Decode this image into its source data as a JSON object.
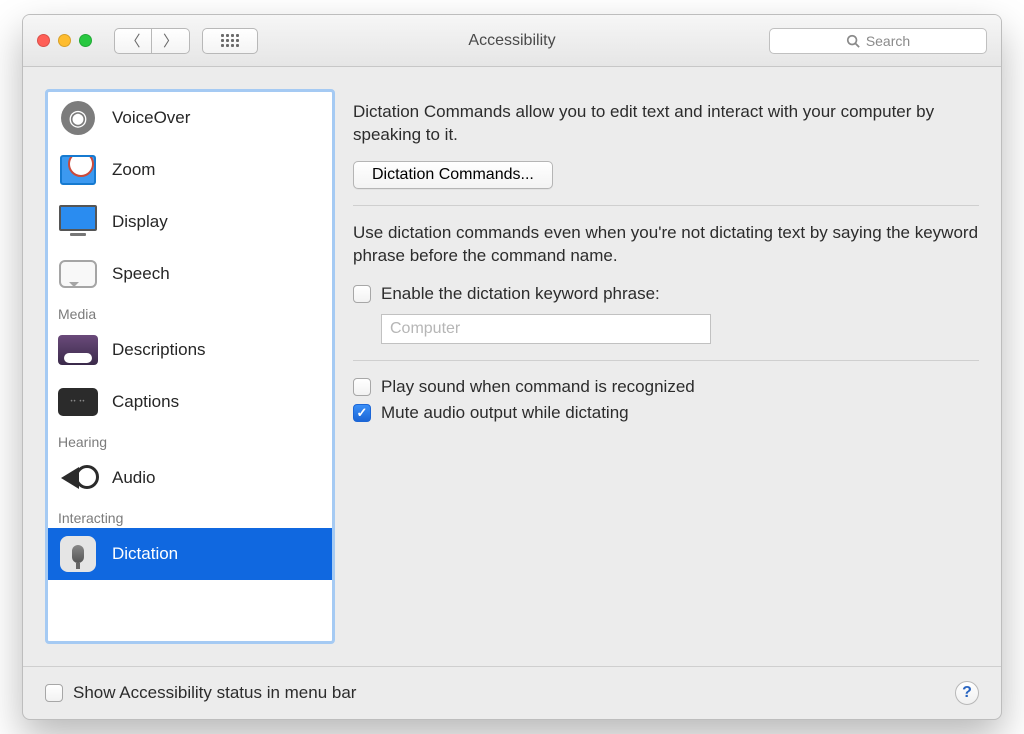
{
  "window": {
    "title": "Accessibility",
    "search_placeholder": "Search"
  },
  "sidebar": {
    "items": [
      {
        "label": "VoiceOver"
      },
      {
        "label": "Zoom"
      },
      {
        "label": "Display"
      },
      {
        "label": "Speech"
      }
    ],
    "section_media": "Media",
    "media_items": [
      {
        "label": "Descriptions"
      },
      {
        "label": "Captions"
      }
    ],
    "section_hearing": "Hearing",
    "hearing_items": [
      {
        "label": "Audio"
      }
    ],
    "section_interacting": "Interacting",
    "interacting_items": [
      {
        "label": "Dictation"
      }
    ]
  },
  "main": {
    "intro": "Dictation Commands allow you to edit text and interact with your computer by speaking to it.",
    "commands_button": "Dictation Commands...",
    "keyword_intro": "Use dictation commands even when you're not dictating text by saying the keyword phrase before the command name.",
    "enable_keyword_label": "Enable the dictation keyword phrase:",
    "keyword_value": "Computer",
    "play_sound_label": "Play sound when command is recognized",
    "mute_label": "Mute audio output while dictating"
  },
  "footer": {
    "status_label": "Show Accessibility status in menu bar"
  }
}
